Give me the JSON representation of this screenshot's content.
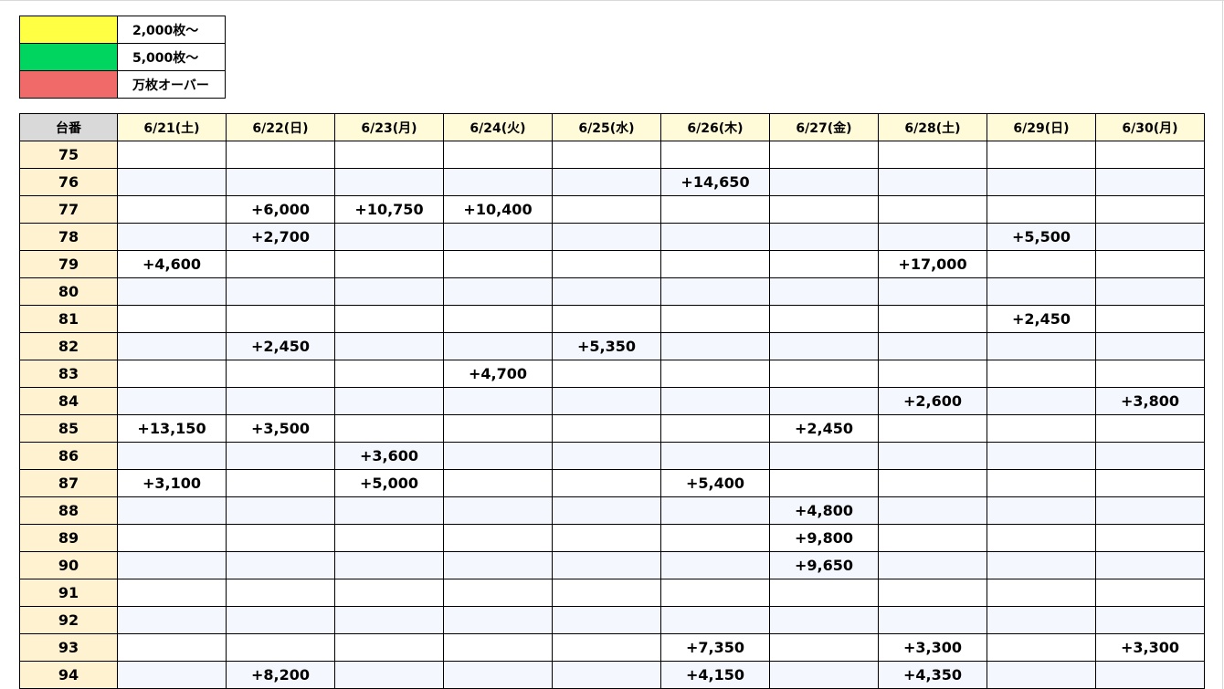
{
  "legend": {
    "items": [
      {
        "label": "2,000枚～",
        "color": "#ffff44"
      },
      {
        "label": "5,000枚～",
        "color": "#00d55f"
      },
      {
        "label": "万枚オーバー",
        "color": "#f06a6a"
      }
    ]
  },
  "table": {
    "corner_label": "台番",
    "dates": [
      "6/21(土)",
      "6/22(日)",
      "6/23(月)",
      "6/24(火)",
      "6/25(水)",
      "6/26(木)",
      "6/27(金)",
      "6/28(土)",
      "6/29(日)",
      "6/30(月)"
    ],
    "rows": [
      {
        "num": "75",
        "cells": [
          "",
          "",
          "",
          "",
          "",
          "",
          "",
          "",
          "",
          ""
        ]
      },
      {
        "num": "76",
        "cells": [
          "",
          "",
          "",
          "",
          "",
          "+14,650",
          "",
          "",
          "",
          ""
        ]
      },
      {
        "num": "77",
        "cells": [
          "",
          "+6,000",
          "+10,750",
          "+10,400",
          "",
          "",
          "",
          "",
          "",
          ""
        ]
      },
      {
        "num": "78",
        "cells": [
          "",
          "+2,700",
          "",
          "",
          "",
          "",
          "",
          "",
          "+5,500",
          ""
        ]
      },
      {
        "num": "79",
        "cells": [
          "+4,600",
          "",
          "",
          "",
          "",
          "",
          "",
          "+17,000",
          "",
          ""
        ]
      },
      {
        "num": "80",
        "cells": [
          "",
          "",
          "",
          "",
          "",
          "",
          "",
          "",
          "",
          ""
        ]
      },
      {
        "num": "81",
        "cells": [
          "",
          "",
          "",
          "",
          "",
          "",
          "",
          "",
          "+2,450",
          ""
        ]
      },
      {
        "num": "82",
        "cells": [
          "",
          "+2,450",
          "",
          "",
          "+5,350",
          "",
          "",
          "",
          "",
          ""
        ]
      },
      {
        "num": "83",
        "cells": [
          "",
          "",
          "",
          "+4,700",
          "",
          "",
          "",
          "",
          "",
          ""
        ]
      },
      {
        "num": "84",
        "cells": [
          "",
          "",
          "",
          "",
          "",
          "",
          "",
          "+2,600",
          "",
          "+3,800"
        ]
      },
      {
        "num": "85",
        "cells": [
          "+13,150",
          "+3,500",
          "",
          "",
          "",
          "",
          "+2,450",
          "",
          "",
          ""
        ]
      },
      {
        "num": "86",
        "cells": [
          "",
          "",
          "+3,600",
          "",
          "",
          "",
          "",
          "",
          "",
          ""
        ]
      },
      {
        "num": "87",
        "cells": [
          "+3,100",
          "",
          "+5,000",
          "",
          "",
          "+5,400",
          "",
          "",
          "",
          ""
        ]
      },
      {
        "num": "88",
        "cells": [
          "",
          "",
          "",
          "",
          "",
          "",
          "+4,800",
          "",
          "",
          ""
        ]
      },
      {
        "num": "89",
        "cells": [
          "",
          "",
          "",
          "",
          "",
          "",
          "+9,800",
          "",
          "",
          ""
        ]
      },
      {
        "num": "90",
        "cells": [
          "",
          "",
          "",
          "",
          "",
          "",
          "+9,650",
          "",
          "",
          ""
        ]
      },
      {
        "num": "91",
        "cells": [
          "",
          "",
          "",
          "",
          "",
          "",
          "",
          "",
          "",
          ""
        ]
      },
      {
        "num": "92",
        "cells": [
          "",
          "",
          "",
          "",
          "",
          "",
          "",
          "",
          "",
          ""
        ]
      },
      {
        "num": "93",
        "cells": [
          "",
          "",
          "",
          "",
          "",
          "+7,350",
          "",
          "+3,300",
          "",
          "+3,300"
        ]
      },
      {
        "num": "94",
        "cells": [
          "",
          "+8,200",
          "",
          "",
          "",
          "+4,150",
          "",
          "+4,350",
          "",
          ""
        ]
      }
    ]
  }
}
